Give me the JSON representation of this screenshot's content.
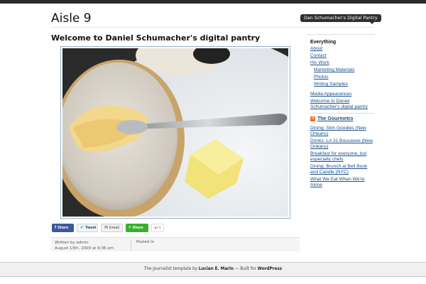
{
  "site": {
    "title": "Aisle 9",
    "tagline": "Dan Schumacher's Digital Pantry"
  },
  "post": {
    "title": "Welcome to Daniel Schumacher's digital pantry",
    "meta_written": "Written by admin",
    "meta_date": "August 13th, 2009 at 9:36 am",
    "meta_posted": "Posted in"
  },
  "share": {
    "facebook": "Share",
    "twitter": "Tweet",
    "email": "Email",
    "share": "Share",
    "gplus": "g+1"
  },
  "sidebar": {
    "heading": "Everything",
    "links": [
      "About",
      "Contact",
      "His Work"
    ],
    "sublinks": [
      "Marketing Materials",
      "Photos",
      "Writing Samples"
    ],
    "links2": [
      "Media Appearances",
      "Welcome to Daniel Schumacher's digital pantry"
    ],
    "rss_title": "The Gourmetro",
    "rss_items": [
      "Dining: Slim Goodies (New Orleans)",
      "Drinks: LA 31 Boucanee (New Orleans)",
      "Breakfast for everyone, but especially chefs",
      "Dining: Brunch at Bell Book and Candle (NYC)",
      "What We Eat When We're Alone"
    ]
  },
  "footer": {
    "pre": "The Journalist template by ",
    "author": "Lucian E. Marin",
    "mid": " — Built for ",
    "platform": "WordPress"
  },
  "colors": {
    "link": "#1a4f8a",
    "facebook": "#3b5998",
    "share_green": "#3aaf2f"
  }
}
